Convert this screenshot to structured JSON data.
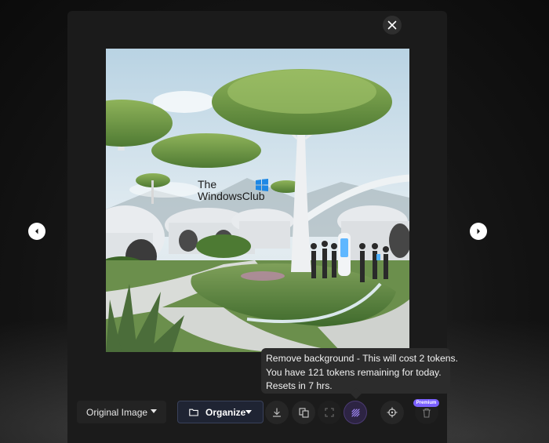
{
  "viewer": {
    "close_label": "Close",
    "prev_label": "Previous image",
    "next_label": "Next image"
  },
  "watermark": {
    "line1": "The",
    "line2": "WindowsClub"
  },
  "tooltip": {
    "line1": "Remove background - This will cost 2 tokens.",
    "line2": "You have 121 tokens remaining for today.",
    "line3": "Resets in 7 hrs."
  },
  "toolbar": {
    "view_select": "Original Image",
    "organize_label": "Organize",
    "premium_badge": "Premium",
    "icons": [
      "download-icon",
      "copy-icon",
      "expand-icon",
      "remove-background-icon",
      "crosshair-icon",
      "trash-icon"
    ]
  },
  "colors": {
    "modal_bg": "#1b1b1b",
    "accent": "#7b61ff",
    "organize_bg": "#1f2433"
  }
}
